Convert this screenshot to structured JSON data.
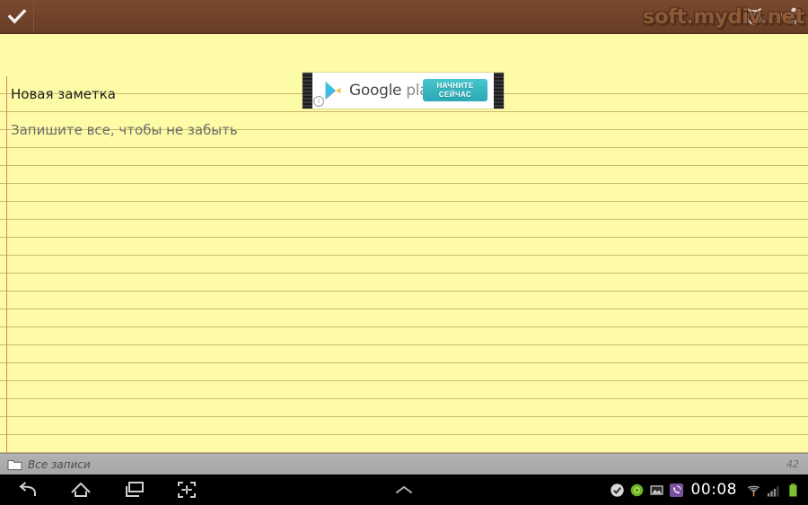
{
  "action_bar": {
    "confirm_icon": "check-icon",
    "alarm_icon": "alarm-clock-icon",
    "share_icon": "share-icon",
    "watermark": "soft.mydiv.net",
    "bar_color": "#70422a"
  },
  "ad": {
    "brand_bold": "Google",
    "brand_light": " play",
    "cta_line1": "НАЧНИТЕ",
    "cta_line2": "СЕЙЧАС",
    "info_glyph": "i",
    "cta_color": "#2aa8b4"
  },
  "note": {
    "title": "Новая заметка",
    "body_placeholder": "Запишите все, чтобы не забыть",
    "paper_color": "#fdfba6",
    "rule_color": "#c9b96e",
    "margin_color": "#d9836b"
  },
  "app_status": {
    "folder_icon": "folder-icon",
    "folder_label": "Все записи",
    "counter": "42"
  },
  "navbar": {
    "back_icon": "back-arrow-icon",
    "home_icon": "home-icon",
    "recents_icon": "recent-apps-icon",
    "screenshot_icon": "screen-capture-icon",
    "expand_icon": "chevron-up-icon",
    "status_icons": [
      "check-badge-icon",
      "green-app-icon",
      "screenshot-saved-icon",
      "viber-icon"
    ],
    "clock": "00:08",
    "wifi_icon": "wifi-icon",
    "signal_icon": "cellular-signal-icon",
    "battery_icon": "battery-full-icon"
  }
}
